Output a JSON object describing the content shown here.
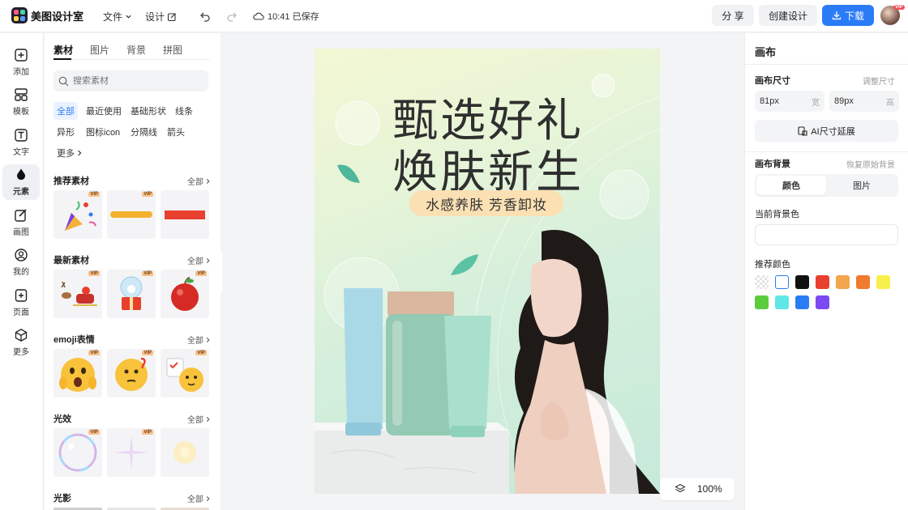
{
  "app": {
    "name": "美图设计室"
  },
  "topbar": {
    "menu_file": "文件",
    "menu_design": "设计",
    "save_status": "10:41 已保存",
    "share_label": "分 享",
    "create_label": "创建设计",
    "download_label": "下载",
    "avatar_badge": "VIP"
  },
  "rail": {
    "items": [
      {
        "label": "添加"
      },
      {
        "label": "模板"
      },
      {
        "label": "文字"
      },
      {
        "label": "元素"
      },
      {
        "label": "画图"
      },
      {
        "label": "我的"
      },
      {
        "label": "页面"
      },
      {
        "label": "更多"
      }
    ]
  },
  "assets": {
    "tabs": [
      "素材",
      "图片",
      "背景",
      "拼图"
    ],
    "search_placeholder": "搜索素材",
    "chips": [
      "全部",
      "最近使用",
      "基础形状",
      "线条",
      "异形",
      "图标icon",
      "分隔线",
      "箭头",
      "更多"
    ],
    "all_label": "全部",
    "vip_badge": "VIP",
    "sections": [
      {
        "title": "推荐素材"
      },
      {
        "title": "最新素材"
      },
      {
        "title": "emoji表情"
      },
      {
        "title": "光效"
      },
      {
        "title": "光影"
      }
    ]
  },
  "poster": {
    "title_line1": "甄选好礼",
    "title_line2": "焕肤新生",
    "tagline": "水感养肤 芳香卸妆"
  },
  "zoom": {
    "value": "100%"
  },
  "right_panel": {
    "title": "画布",
    "size_label": "画布尺寸",
    "resize_link": "调整尺寸",
    "width_value": "81px",
    "width_unit": "宽",
    "height_value": "89px",
    "height_unit": "高",
    "ai_resize_label": "AI尺寸延展",
    "bg_label": "画布背景",
    "restore_link": "恢复原始背景",
    "seg_color": "颜色",
    "seg_image": "图片",
    "current_bg_label": "当前背景色",
    "recommend_label": "推荐颜色",
    "colors": [
      "transparent",
      "#ffffff",
      "#111111",
      "#e8402e",
      "#f3a64b",
      "#f07a2e",
      "#f7ef4a",
      "#5ccc3f",
      "#5fe6e6",
      "#2a7cf6",
      "#7b4af0"
    ]
  }
}
